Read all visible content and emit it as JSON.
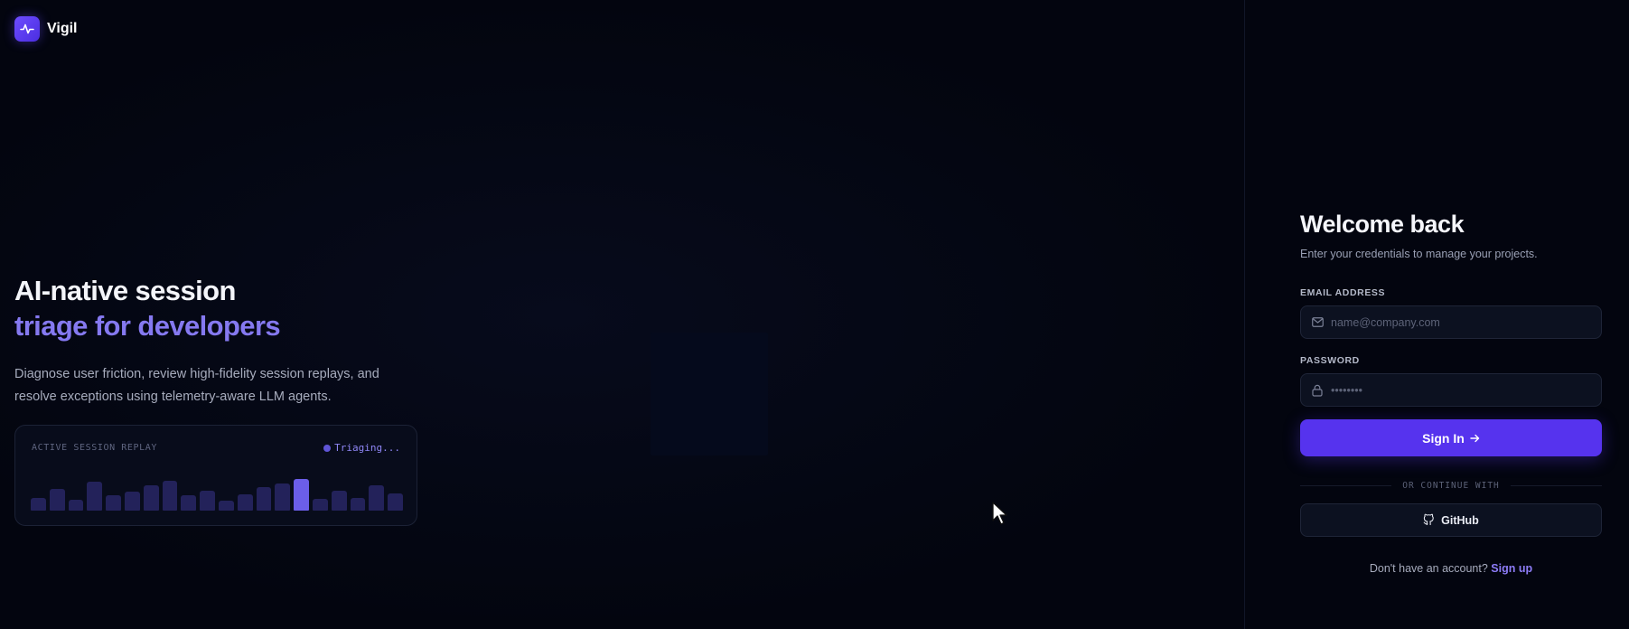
{
  "brand": {
    "name": "Vigil",
    "logo_icon": "pulse-icon"
  },
  "hero": {
    "title_line1": "AI-native session",
    "title_line2": "triage for developers",
    "description": "Diagnose user friction, review high-fidelity session replays, and resolve exceptions using telemetry-aware LLM agents."
  },
  "replay_card": {
    "label": "ACTIVE SESSION REPLAY",
    "status": "Triaging...",
    "activity_bars": [
      0.35,
      0.6,
      0.3,
      0.8,
      0.42,
      0.52,
      0.7,
      0.82,
      0.42,
      0.55,
      0.28,
      0.45,
      0.65,
      0.75,
      0.88,
      0.32,
      0.55,
      0.36,
      0.7,
      0.47
    ],
    "active_bar_index": 14
  },
  "login": {
    "title": "Welcome back",
    "subtitle": "Enter your credentials to manage your projects.",
    "email_label": "EMAIL ADDRESS",
    "email_placeholder": "name@company.com",
    "password_label": "PASSWORD",
    "password_placeholder": "••••••••",
    "signin_label": "Sign In",
    "divider_text": "OR CONTINUE WITH",
    "github_label": "GitHub",
    "signup_prompt": "Don't have an account?",
    "signup_link": "Sign up"
  },
  "colors": {
    "background": "#03050f",
    "accent": "#5633ee",
    "accent_text": "#8579f0",
    "bar": "#23225a",
    "bar_active": "#6b5ee8"
  }
}
